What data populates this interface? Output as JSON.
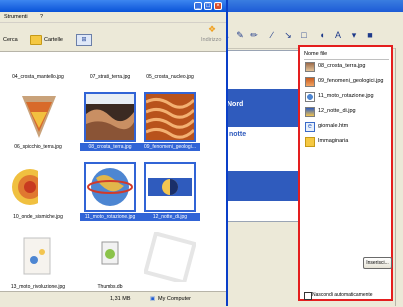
{
  "explorer": {
    "menu": {
      "tools": "Strumenti",
      "help": "?"
    },
    "toolbar": {
      "search": "Cerca",
      "folders": "Cartelle",
      "views_icon": "views-icon",
      "address_label": "Indirizzo"
    },
    "thumbnails": [
      {
        "name": "04_crosta_mantello.jpg",
        "selected": false
      },
      {
        "name": "07_strati_terra.jpg",
        "selected": false
      },
      {
        "name": "05_crosta_nucleo.jpg",
        "selected": false
      },
      {
        "name": "06_spicchio_terra.jpg",
        "selected": false
      },
      {
        "name": "08_crosta_terra.jpg",
        "selected": true
      },
      {
        "name": "09_fenomeni_geologi...",
        "selected": true
      },
      {
        "name": "10_onde_sismiche.jpg",
        "selected": false
      },
      {
        "name": "11_moto_rotazione.jpg",
        "selected": true
      },
      {
        "name": "12_notte_di.jpg",
        "selected": true
      },
      {
        "name": "13_moto_rivoluzione.jpg",
        "selected": false
      },
      {
        "name": "Thumbs.db",
        "selected": false
      }
    ],
    "status": {
      "size": "1,31 MB",
      "location": "My Computer"
    }
  },
  "slide": {
    "line1": "Nord",
    "line2": "notte"
  },
  "files_panel": {
    "header": "Nome file",
    "items": [
      {
        "name": "08_crosta_terra.jpg",
        "icon": "image-file-icon"
      },
      {
        "name": "09_fenomeni_geologici.jpg",
        "icon": "image-file-icon"
      },
      {
        "name": "11_moto_rotazione.jpg",
        "icon": "image-file-icon"
      },
      {
        "name": "12_notte_di.jpg",
        "icon": "image-file-icon"
      },
      {
        "name": "giornale.htm",
        "icon": "html-file-icon"
      },
      {
        "name": "Immaginaria",
        "icon": "folder-icon"
      }
    ],
    "insert_button": "Inserisci...",
    "checkbox_label": "Nascondi automaticamente"
  },
  "colors": {
    "highlight": "#e41e1e",
    "selection": "#3164d6",
    "titlebar": "#0a53d8"
  }
}
